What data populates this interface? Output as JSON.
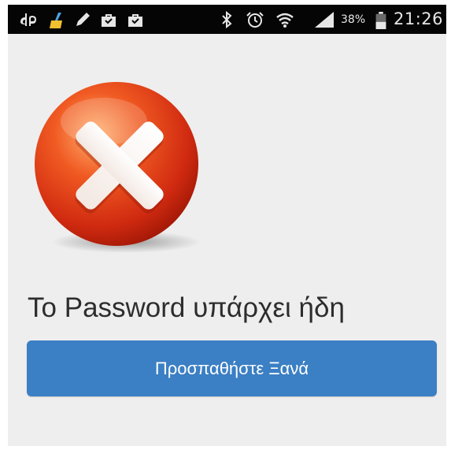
{
  "status_bar": {
    "battery_percent": "38%",
    "time": "21:26",
    "icons": [
      "app-notification-icon",
      "cleaner-icon",
      "edit-icon",
      "briefcase-icon",
      "briefcase-check-icon",
      "bluetooth-icon",
      "alarm-icon",
      "wifi-icon",
      "signal-icon",
      "battery-icon"
    ]
  },
  "dialog": {
    "icon": "error-x-icon",
    "message": "Το Password υπάρχει ήδη",
    "retry_label": "Προσπαθήστε Ξανά"
  },
  "colors": {
    "button": "#3b7fc4",
    "background": "#eeeeee",
    "status_bar": "#050505",
    "error_red": "#e8361a"
  }
}
